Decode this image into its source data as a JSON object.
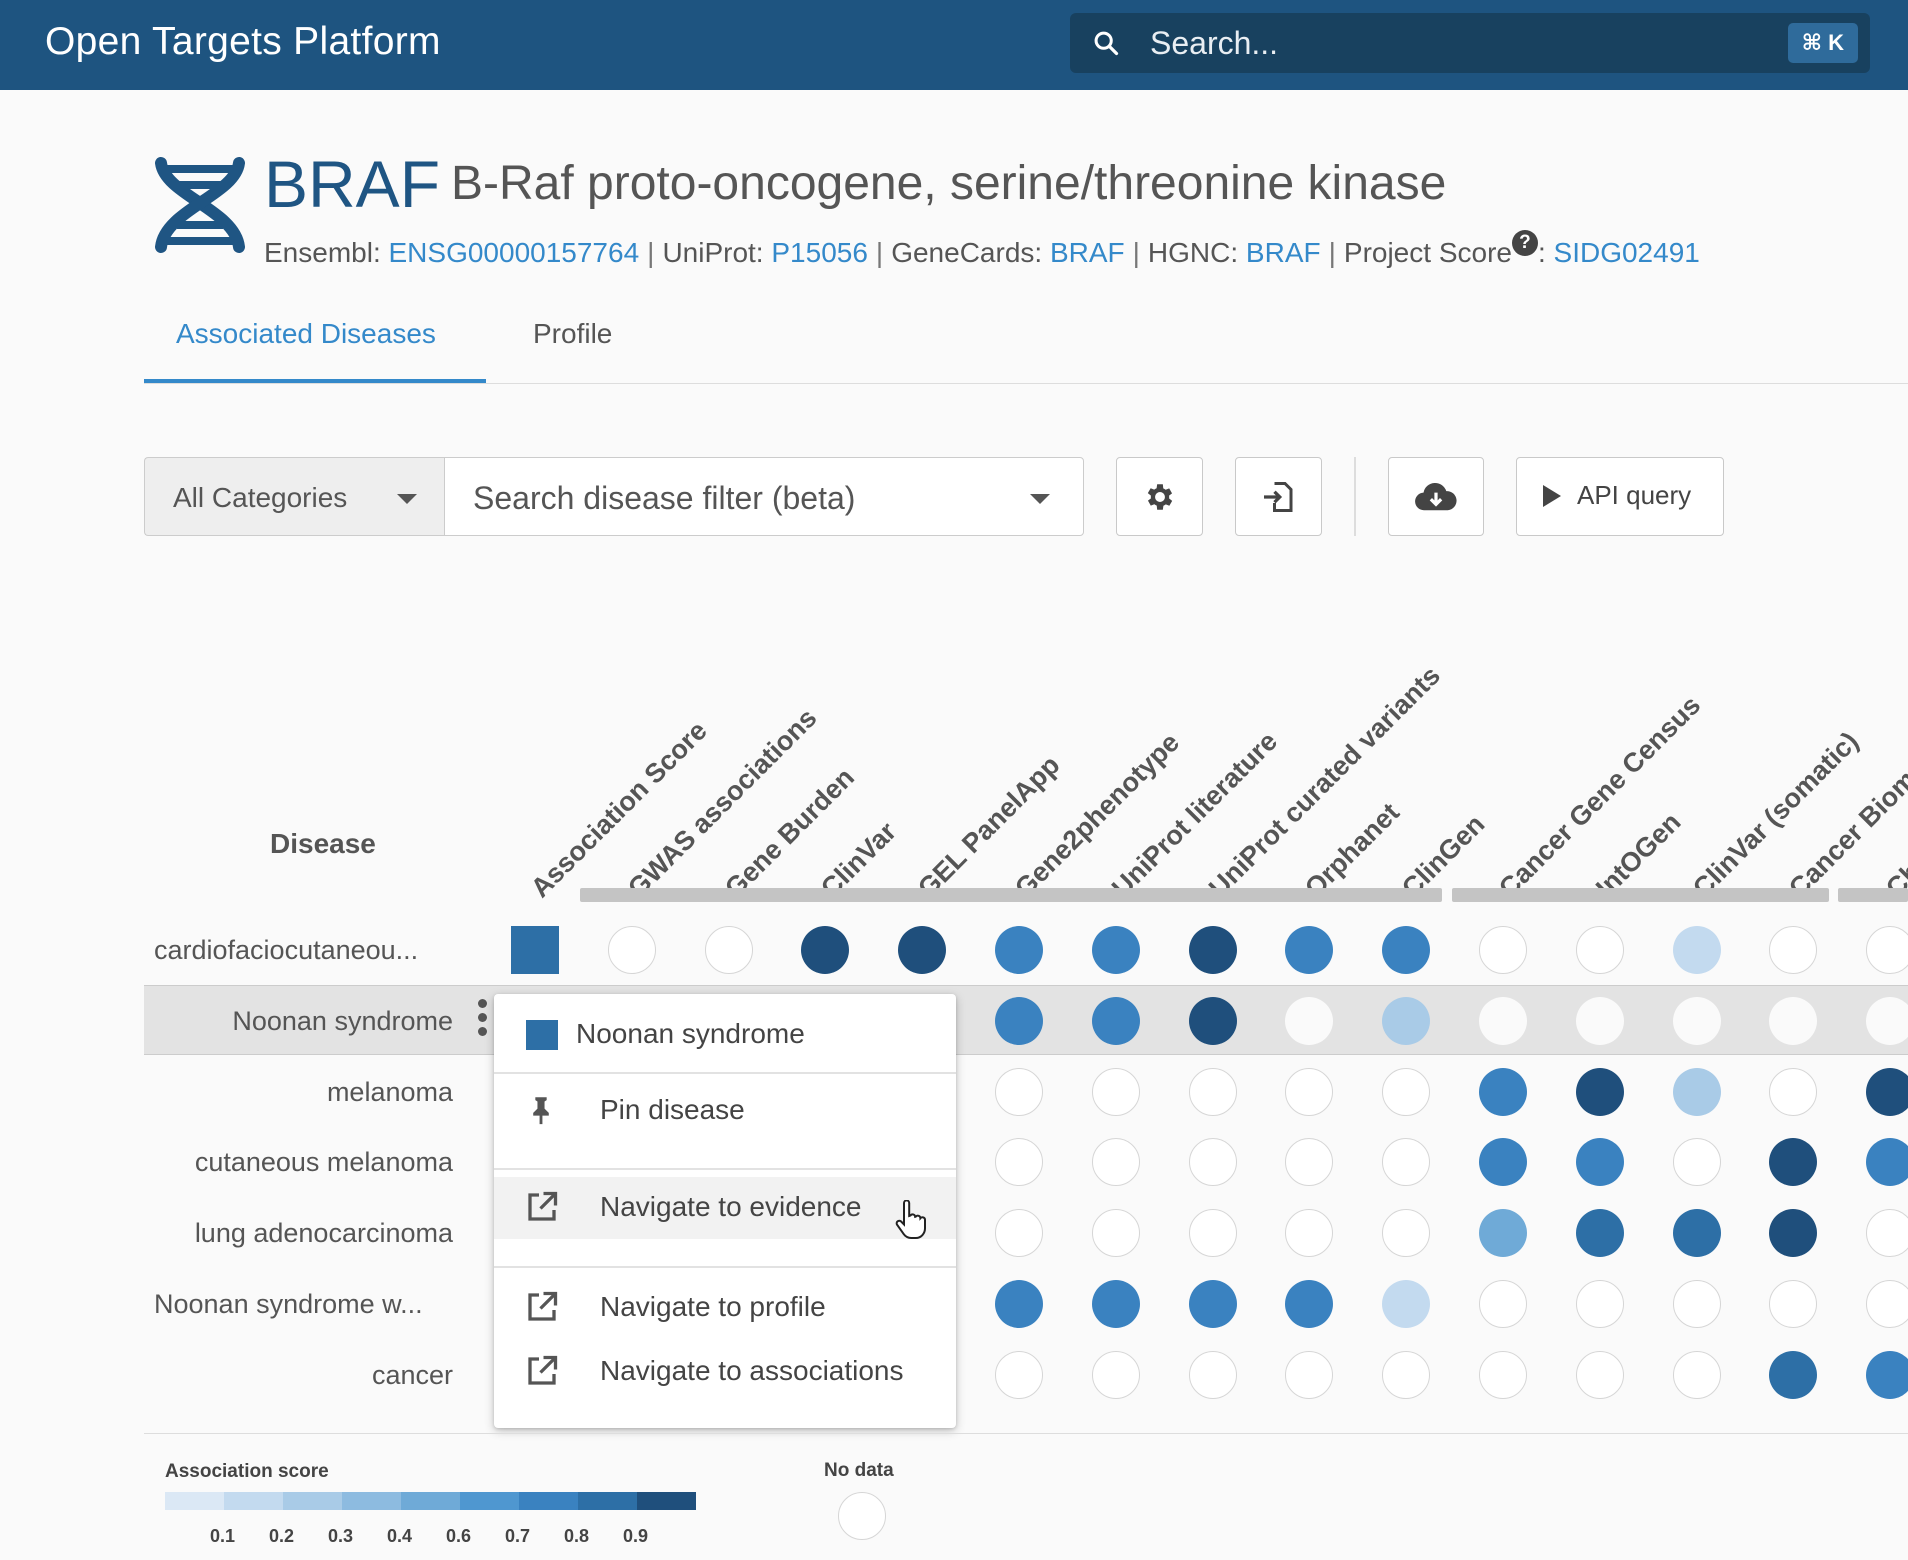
{
  "header": {
    "brand_bold": "Open Targets",
    "brand_light": " Platform",
    "search_placeholder": "Search...",
    "shortcut": "⌘ K"
  },
  "target": {
    "symbol": "BRAF",
    "name": "B-Raf proto-oncogene, serine/threonine kinase",
    "ids": [
      {
        "label": "Ensembl: ",
        "value": "ENSG00000157764"
      },
      {
        "label": "UniProt: ",
        "value": "P15056"
      },
      {
        "label": "GeneCards: ",
        "value": "BRAF"
      },
      {
        "label": "HGNC: ",
        "value": "BRAF"
      },
      {
        "label": "Project Score",
        "value": "SIDG02491",
        "help": "?"
      }
    ]
  },
  "tabs": [
    {
      "label": "Associated Diseases",
      "active": true
    },
    {
      "label": "Profile",
      "active": false
    }
  ],
  "toolbar": {
    "category": "All Categories",
    "disease_search_placeholder": "Search disease filter (beta)",
    "api_label": "API query"
  },
  "grid": {
    "disease_header": "Disease",
    "columns": [
      "Association Score",
      "GWAS associations",
      "Gene Burden",
      "ClinVar",
      "GEL PanelApp",
      "Gene2phenotype",
      "UniProt literature",
      "UniProt curated variants",
      "Orphanet",
      "ClinGen",
      "Cancer Gene Census",
      "IntOGen",
      "ClinVar (somatic)",
      "Cancer Biomarkers",
      "ChEMBL"
    ],
    "rows": [
      {
        "name": "cardiofaciocutaneou...",
        "cells": [
          "sq",
          null,
          null,
          0.95,
          0.95,
          0.8,
          0.7,
          0.95,
          0.7,
          0.7,
          null,
          null,
          0.1,
          null,
          null
        ]
      },
      {
        "name": "Noonan syndrome",
        "cells": [
          "sq",
          null,
          null,
          null,
          null,
          0.7,
          0.7,
          0.95,
          "w",
          0.3,
          "w",
          "w",
          "w",
          "w",
          "w"
        ]
      },
      {
        "name": "melanoma",
        "cells": [
          "sq",
          null,
          null,
          null,
          null,
          null,
          null,
          null,
          null,
          null,
          0.7,
          0.95,
          0.2,
          null,
          0.95
        ]
      },
      {
        "name": "cutaneous melanoma",
        "cells": [
          "sq",
          null,
          null,
          null,
          null,
          null,
          null,
          null,
          null,
          null,
          0.7,
          0.7,
          null,
          0.95,
          0.7
        ]
      },
      {
        "name": "lung adenocarcinoma",
        "cells": [
          "sq",
          null,
          null,
          null,
          null,
          null,
          null,
          null,
          null,
          null,
          0.5,
          0.9,
          0.85,
          0.95,
          null
        ]
      },
      {
        "name": "Noonan syndrome w...",
        "cells": [
          "sq",
          null,
          null,
          null,
          null,
          0.7,
          0.7,
          0.7,
          0.7,
          0.1,
          null,
          null,
          null,
          null,
          null
        ]
      },
      {
        "name": "cancer",
        "cells": [
          "sq",
          null,
          null,
          null,
          null,
          null,
          null,
          null,
          null,
          null,
          null,
          null,
          null,
          0.85,
          0.7
        ]
      }
    ]
  },
  "context_menu": {
    "title": "Noonan syndrome",
    "items": [
      {
        "label": "Pin disease",
        "icon": "pin-icon"
      },
      {
        "label": "Navigate to evidence",
        "icon": "external-link-icon"
      },
      {
        "label": "Navigate to profile",
        "icon": "external-link-icon"
      },
      {
        "label": "Navigate to associations",
        "icon": "external-link-icon"
      }
    ]
  },
  "legend": {
    "title": "Association score",
    "ticks": [
      "0.1",
      "0.2",
      "0.3",
      "0.4",
      "0.6",
      "0.7",
      "0.8",
      "0.9"
    ],
    "colors": [
      "#dbe8f5",
      "#c3daef",
      "#a9cbe7",
      "#8dbbe0",
      "#6faad7",
      "#4f97d0",
      "#3a82c0",
      "#2d6fa6",
      "#1f4f7c"
    ],
    "no_data": "No data"
  }
}
